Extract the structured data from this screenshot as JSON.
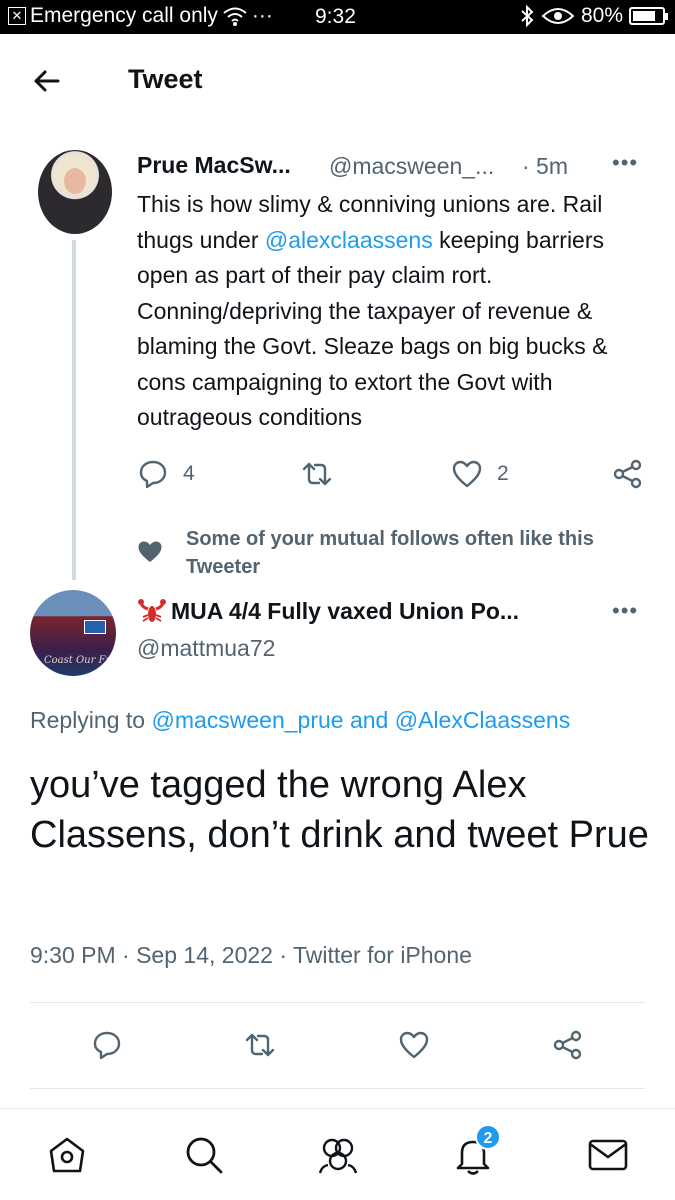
{
  "status_bar": {
    "carrier": "Emergency call only",
    "dots": "···",
    "time": "9:32",
    "battery": "80%",
    "battery_level": 0.8
  },
  "header": {
    "title": "Tweet"
  },
  "parent_tweet": {
    "name": "Prue MacSw...",
    "handle": "@macsween_...",
    "time": "· 5m",
    "more": "•••",
    "text_before_mention": "This is how slimy & conniving unions are. Rail thugs under ",
    "mention": "@alexclaassens",
    "text_after_mention": " keeping barriers open as part of their pay claim rort. Conning/depriving the taxpayer of revenue & blaming the Govt. Sleaze bags on big bucks & cons campaigning to extort the Govt with outrageous conditions",
    "reply_count": "4",
    "like_count": "2",
    "social_context": "Some of your mutual follows often like this Tweeter"
  },
  "main_tweet": {
    "name": "MUA 4/4 Fully vaxed Union Po...",
    "handle": "@mattmua72",
    "more": "•••",
    "replying_prefix": "Replying to ",
    "replying_to": "@macsween_prue and @AlexClaassens",
    "text": "you’ve tagged the wrong Alex Classens, don’t drink and tweet Prue",
    "meta": "9:30 PM · Sep 14, 2022 · Twitter for iPhone",
    "avatar_caption": "Coast Our Fu"
  },
  "bottom_nav": {
    "items": [
      "home",
      "search",
      "communities",
      "notifications",
      "messages"
    ],
    "notification_badge": "2"
  },
  "colors": {
    "accent": "#1d9bf0",
    "secondary_text": "#536471",
    "primary_text": "#0f1419"
  }
}
